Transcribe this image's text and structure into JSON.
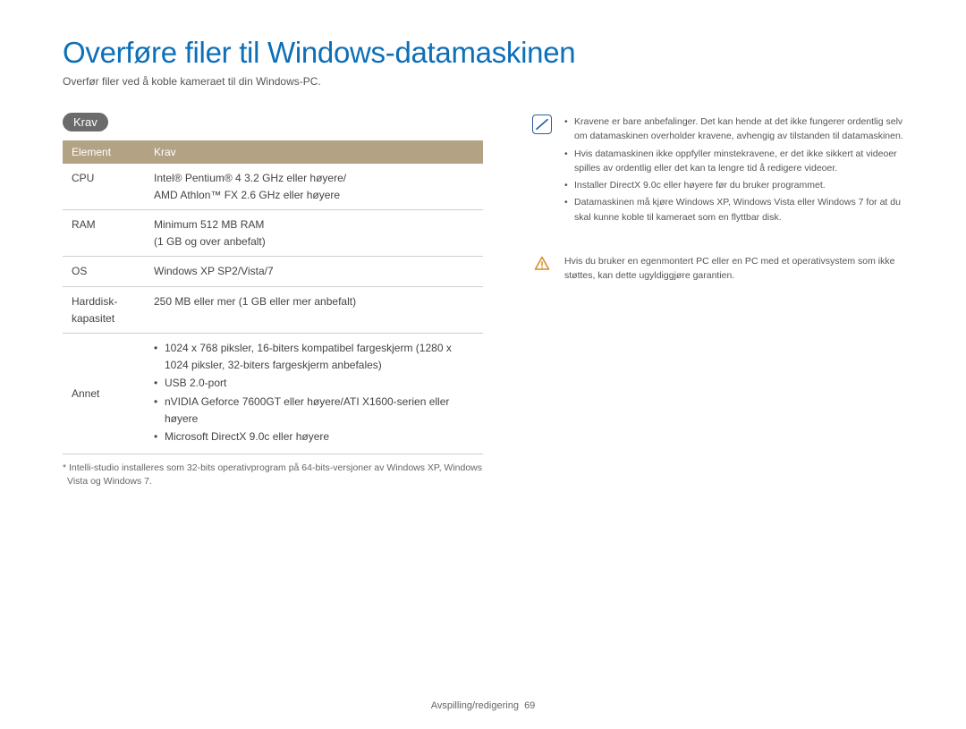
{
  "title": "Overføre filer til Windows-datamaskinen",
  "subtitle": "Overfør filer ved å koble kameraet til din Windows-PC.",
  "section_label": "Krav",
  "table": {
    "headers": {
      "element": "Element",
      "krav": "Krav"
    },
    "rows": {
      "cpu": {
        "label": "CPU",
        "value": "Intel® Pentium® 4 3.2 GHz eller høyere/\nAMD Athlon™ FX 2.6 GHz eller høyere"
      },
      "ram": {
        "label": "RAM",
        "value": "Minimum 512 MB RAM\n(1 GB og over anbefalt)"
      },
      "os": {
        "label": "OS",
        "value": "Windows XP SP2/Vista/7"
      },
      "hdd": {
        "label": "Harddisk-\nkapasitet",
        "value": "250 MB eller mer (1 GB eller mer anbefalt)"
      },
      "other": {
        "label": "Annet",
        "items": [
          "1024 x 768 piksler, 16-biters kompatibel fargeskjerm (1280 x 1024 piksler, 32-biters fargeskjerm anbefales)",
          "USB 2.0-port",
          "nVIDIA Geforce 7600GT eller høyere/ATI X1600-serien eller høyere",
          "Microsoft DirectX 9.0c eller høyere"
        ]
      }
    }
  },
  "footnote": "* Intelli-studio installeres som 32-bits operativprogram på 64-bits-versjoner av Windows XP, Windows Vista og Windows 7.",
  "info_callout": [
    "Kravene er bare anbefalinger. Det kan hende at det ikke fungerer ordentlig selv om datamaskinen overholder kravene, avhengig av tilstanden til datamaskinen.",
    "Hvis datamaskinen ikke oppfyller minstekravene, er det ikke sikkert at videoer spilles av ordentlig eller det kan ta lengre tid å redigere videoer.",
    "Installer DirectX 9.0c eller høyere før du bruker programmet.",
    "Datamaskinen må kjøre Windows XP, Windows Vista eller Windows 7 for at du skal kunne koble til kameraet som en flyttbar disk."
  ],
  "warn_callout": "Hvis du bruker en egenmontert PC eller en PC med et operativsystem som ikke støttes, kan dette ugyldiggjøre garantien.",
  "footer": {
    "section": "Avspilling/redigering",
    "page": "69"
  }
}
